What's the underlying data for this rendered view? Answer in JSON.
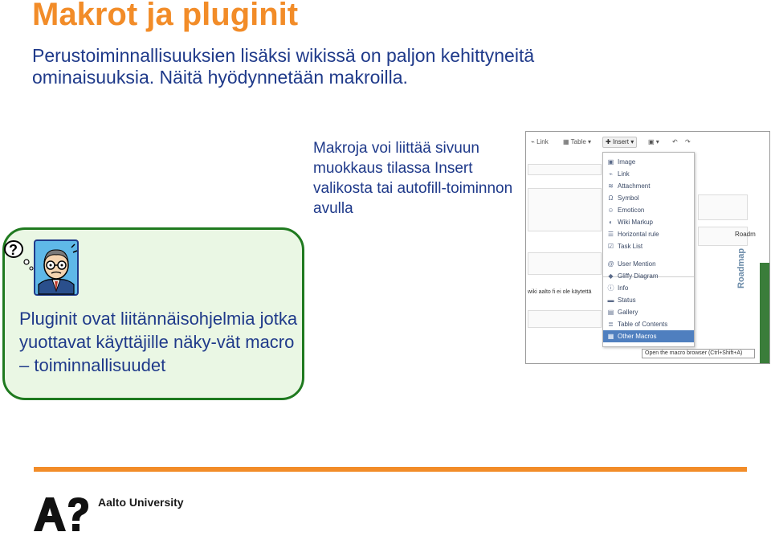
{
  "slide": {
    "title": "Makrot ja pluginit",
    "lead": "Perustoiminnallisuuksien lisäksi wikissä on paljon kehittyneitä ominaisuuksia. Näitä hyödynnetään makroilla.",
    "note": "Makroja voi liittää sivuun muokkaus tilassa Insert valikosta tai autofill-toiminnon avulla",
    "callout": "Pluginit ovat liitännäisohjelmia jotka yuottavat käyttäjille näky-vät macro – toiminnallisuudet"
  },
  "screenshot": {
    "toolbar": {
      "link": "Link",
      "table": "Table",
      "insert": "Insert"
    },
    "menu_items": [
      {
        "label": "Image",
        "icon": "image-icon"
      },
      {
        "label": "Link",
        "icon": "link-icon"
      },
      {
        "label": "Attachment",
        "icon": "attachment-icon"
      },
      {
        "label": "Symbol",
        "icon": "symbol-icon"
      },
      {
        "label": "Emoticon",
        "icon": "emoticon-icon"
      },
      {
        "label": "Wiki Markup",
        "icon": "wiki-markup-icon"
      },
      {
        "label": "Horizontal rule",
        "icon": "horizontal-rule-icon"
      },
      {
        "label": "Task List",
        "icon": "task-list-icon"
      },
      {
        "label": "User Mention",
        "icon": "user-mention-icon"
      },
      {
        "label": "Gliffy Diagram",
        "icon": "gliffy-diagram-icon"
      },
      {
        "label": "Info",
        "icon": "info-icon"
      },
      {
        "label": "Status",
        "icon": "status-icon"
      },
      {
        "label": "Gallery",
        "icon": "gallery-icon"
      },
      {
        "label": "Table of Contents",
        "icon": "table-of-contents-icon"
      },
      {
        "label": "Other Macros",
        "icon": "other-macros-icon"
      }
    ],
    "tooltip": "Open the macro browser (Ctrl+Shift+A)",
    "sidebar_label": "Roadmap",
    "roadmap_chip": "Roadm",
    "page_text": "wiki aalto fi ei ole käytettä"
  },
  "footer": {
    "brand": "Aalto University",
    "bar_color": "#f28c28"
  }
}
